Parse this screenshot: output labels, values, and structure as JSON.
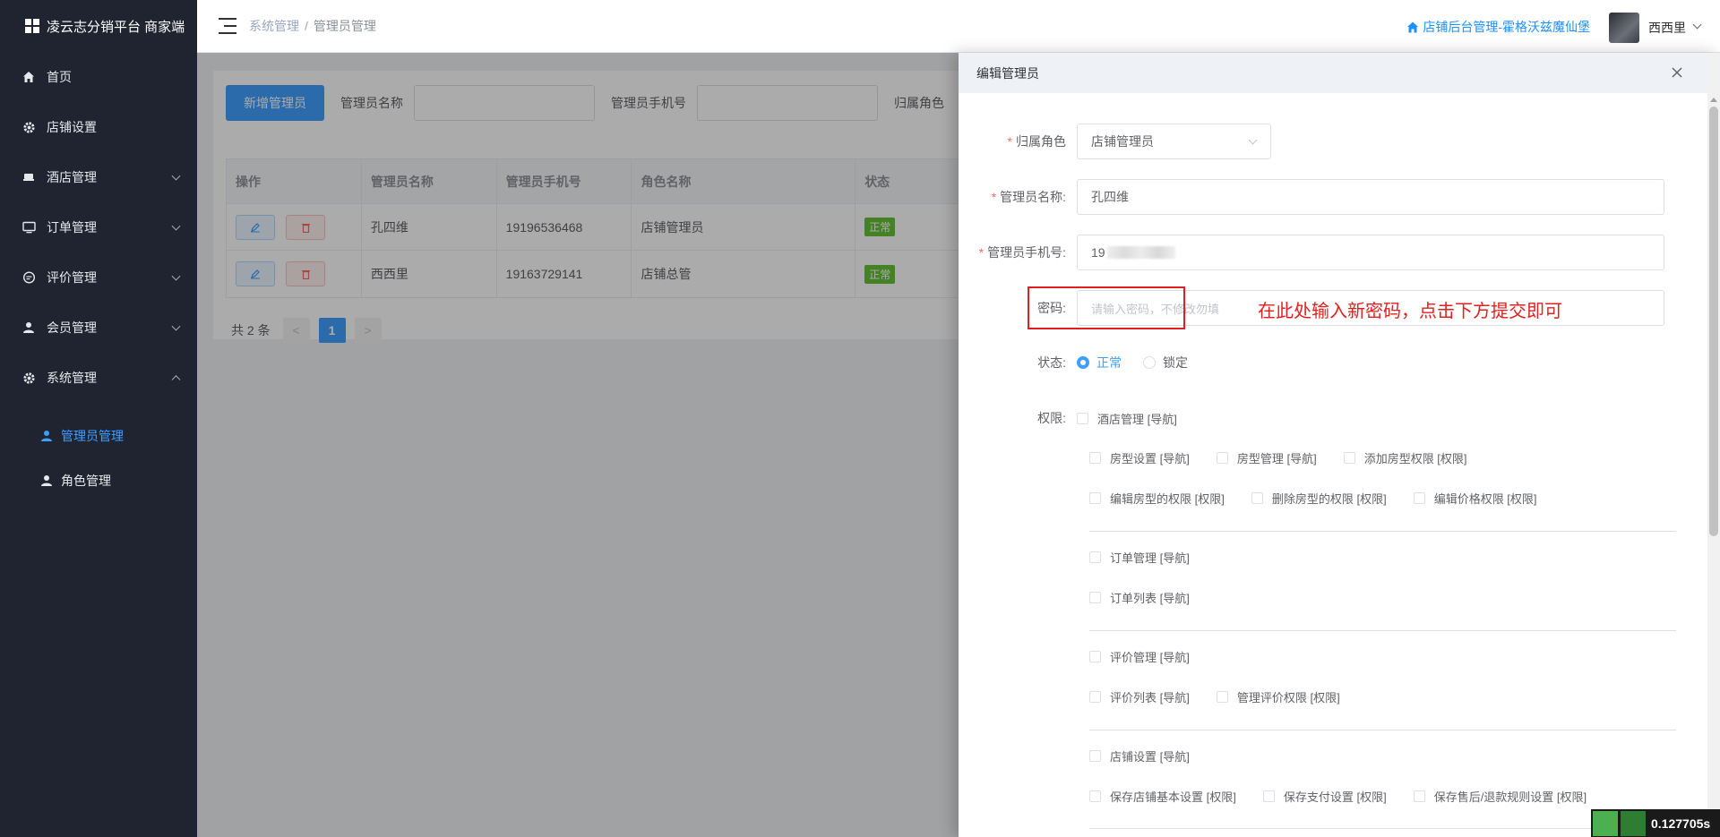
{
  "app": {
    "brand": "凌云志分销平台 商家端"
  },
  "sidebar": {
    "items": [
      {
        "label": "首页",
        "icon": "home-icon"
      },
      {
        "label": "店铺设置",
        "icon": "gear-icon"
      },
      {
        "label": "酒店管理",
        "icon": "bed-icon"
      },
      {
        "label": "订单管理",
        "icon": "monitor-icon"
      },
      {
        "label": "评价管理",
        "icon": "chat-icon"
      },
      {
        "label": "会员管理",
        "icon": "user-icon"
      },
      {
        "label": "系统管理",
        "icon": "gear-icon"
      }
    ],
    "sub_items": [
      {
        "label": "管理员管理",
        "icon": "user-icon"
      },
      {
        "label": "角色管理",
        "icon": "user-icon"
      }
    ]
  },
  "header": {
    "breadcrumb": [
      "系统管理",
      "管理员管理"
    ],
    "store_link": "店铺后台管理-霍格沃兹魔仙堡",
    "username": "西西里"
  },
  "toolbar": {
    "add_button": "新增管理员",
    "name_label": "管理员名称",
    "phone_label": "管理员手机号",
    "role_label": "归属角色"
  },
  "table": {
    "headers": [
      "操作",
      "管理员名称",
      "管理员手机号",
      "角色名称",
      "状态"
    ],
    "rows": [
      {
        "name": "孔四维",
        "phone": "19196536468",
        "role": "店铺管理员",
        "status": "正常"
      },
      {
        "name": "西西里",
        "phone": "19163729141",
        "role": "店铺总管",
        "status": "正常"
      }
    ]
  },
  "pager": {
    "total": "共 2 条",
    "current": "1",
    "prev": "<",
    "next": ">"
  },
  "drawer": {
    "title": "编辑管理员",
    "role_label": "归属角色",
    "role_value": "店铺管理员",
    "name_label": "管理员名称:",
    "name_value": "孔四维",
    "phone_label": "管理员手机号:",
    "phone_value": "19",
    "password_label": "密码:",
    "password_placeholder": "请输入密码，不修改勿填",
    "annotation": "在此处输入新密码，点击下方提交即可",
    "status_label": "状态:",
    "status_options": [
      "正常",
      "锁定"
    ],
    "perm_label": "权限:",
    "permissions": {
      "hotel": [
        "酒店管理 [导航]",
        "房型设置 [导航]",
        "房型管理 [导航]",
        "添加房型权限 [权限]",
        "编辑房型的权限 [权限]",
        "删除房型的权限 [权限]",
        "编辑价格权限 [权限]"
      ],
      "order": [
        "订单管理 [导航]",
        "订单列表 [导航]"
      ],
      "review": [
        "评价管理 [导航]",
        "评价列表 [导航]",
        "管理评价权限 [权限]"
      ],
      "store": [
        "店铺设置 [导航]",
        "保存店铺基本设置 [权限]",
        "保存支付设置 [权限]",
        "保存售后/退款规则设置 [权限]"
      ]
    }
  },
  "badge": {
    "text": "0.127705s"
  },
  "colors": {
    "primary": "#409eff",
    "sidebar": "#1f2430",
    "danger": "#e02020",
    "success": "#67c23a"
  }
}
